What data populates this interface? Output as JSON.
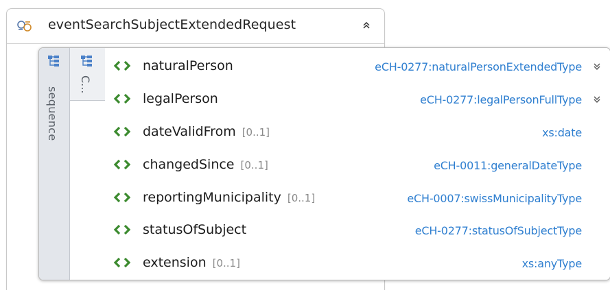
{
  "diagram": {
    "root": {
      "name": "eventSearchSubjectExtendedRequest",
      "icon": "complex-type-icon",
      "collapse_icon": "chevron-double-up-icon"
    },
    "sequence": {
      "label": "sequence",
      "icon": "sequence-icon"
    },
    "choice": {
      "label": "C...",
      "icon": "choice-icon"
    },
    "elements": [
      {
        "name": "naturalPerson",
        "cardinality": "",
        "type": "eCH-0277:naturalPersonExtendedType",
        "expandable": true
      },
      {
        "name": "legalPerson",
        "cardinality": "",
        "type": "eCH-0277:legalPersonFullType",
        "expandable": true
      },
      {
        "name": "dateValidFrom",
        "cardinality": "[0..1]",
        "type": "xs:date",
        "expandable": false
      },
      {
        "name": "changedSince",
        "cardinality": "[0..1]",
        "type": "eCH-0011:generalDateType",
        "expandable": false
      },
      {
        "name": "reportingMunicipality",
        "cardinality": "[0..1]",
        "type": "eCH-0007:swissMunicipalityType",
        "expandable": false
      },
      {
        "name": "statusOfSubject",
        "cardinality": "",
        "type": "eCH-0277:statusOfSubjectType",
        "expandable": false
      },
      {
        "name": "extension",
        "cardinality": "[0..1]",
        "type": "xs:anyType",
        "expandable": false
      }
    ],
    "colors": {
      "element_icon": "#3b8a2e",
      "type_link": "#2f7fd0",
      "tab_background": "#e3e6eb"
    }
  }
}
